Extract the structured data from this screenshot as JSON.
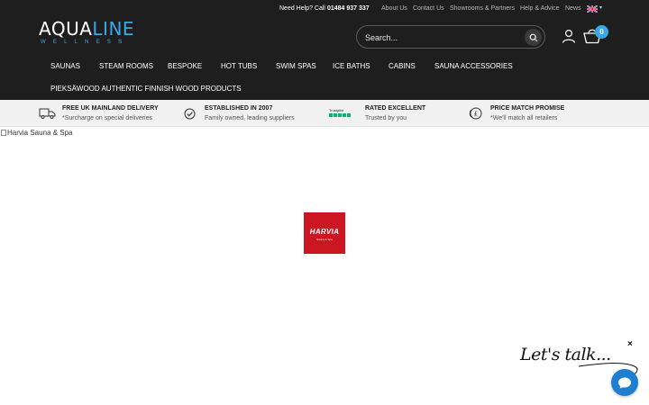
{
  "topbar": {
    "help_label": "Need Help? Call",
    "help_phone": "01484 937 337",
    "links": [
      "About Us",
      "Contact Us",
      "Showrooms & Partners",
      "Help & Advice",
      "News"
    ]
  },
  "brand": {
    "name_part1": "AQUA",
    "name_part2": "LINE",
    "tagline": "WELLNESS"
  },
  "search": {
    "placeholder": "Search..."
  },
  "basket": {
    "count": "0"
  },
  "nav": {
    "items": [
      "SAUNAS",
      "STEAM ROOMS",
      "BESPOKE",
      "HOT TUBS",
      "SWIM SPAS",
      "ICE BATHS",
      "CABINS",
      "SAUNA ACCESSORIES",
      "PIEKSÄWOOD AUTHENTIC FINNISH WOOD PRODUCTS"
    ]
  },
  "usps": [
    {
      "title": "FREE UK MAINLAND DELIVERY",
      "subtitle": "*Surcharge on special deliveries",
      "icon": "delivery-truck-icon"
    },
    {
      "title": "ESTABLISHED IN 2007",
      "subtitle": "Family owned, leading suppliers",
      "icon": "check-circle-icon"
    },
    {
      "title": "RATED EXCELLENT",
      "subtitle": "Trusted by you",
      "icon": "trustpilot-icon",
      "badge_label": "Trustpilot"
    },
    {
      "title": "PRICE MATCH PROMISE",
      "subtitle": "*We'll match all retailers",
      "icon": "pound-coin-icon"
    }
  ],
  "hero": {
    "broken_image_alt": "Harvia Sauna & Spa"
  },
  "harvia_logo": {
    "name": "HARVIA",
    "tagline": "Sauna & Spa"
  },
  "chat": {
    "tagline": "Let's talk...",
    "close_symbol": "×"
  },
  "colors": {
    "header_bg": "#1e1e1e",
    "accent": "#3aa8e6",
    "usp_bg": "#f1f1f1",
    "harvia_red": "#cc1722",
    "chat_blue": "#1e7fd0"
  }
}
